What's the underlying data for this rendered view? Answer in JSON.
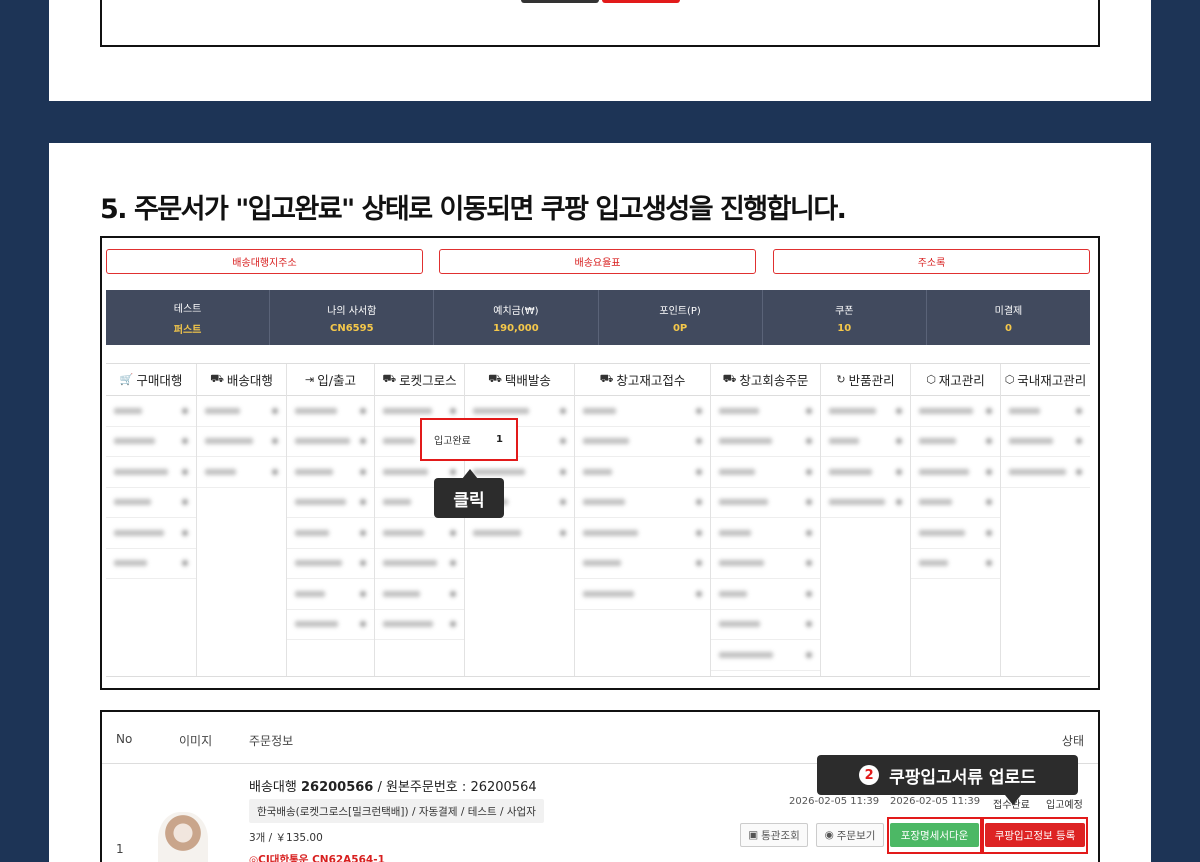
{
  "step": {
    "title": "5. 주문서가 \"입고완료\" 상태로 이동되면 쿠팡 입고생성을 진행합니다."
  },
  "links": [
    {
      "label": "배송대행지주소"
    },
    {
      "label": "배송요율표"
    },
    {
      "label": "주소록"
    }
  ],
  "stats": [
    {
      "label": "테스트",
      "value": "퍼스트"
    },
    {
      "label": "나의 사서함",
      "value": "CN6595"
    },
    {
      "label": "예치금(₩)",
      "value": "190,000"
    },
    {
      "label": "포인트(P)",
      "value": "0P"
    },
    {
      "label": "쿠폰",
      "value": "10"
    },
    {
      "label": "미결제",
      "value": "0"
    }
  ],
  "menu": {
    "columns": [
      {
        "label": "구매대행",
        "icon": "cart-icon"
      },
      {
        "label": "배송대행",
        "icon": "truck-icon"
      },
      {
        "label": "입/출고",
        "icon": "sign-in-icon"
      },
      {
        "label": "로켓그로스",
        "icon": "truck-icon"
      },
      {
        "label": "택배발송",
        "icon": "truck-icon"
      },
      {
        "label": "창고재고접수",
        "icon": "truck-icon"
      },
      {
        "label": "창고회송주문",
        "icon": "truck-icon"
      },
      {
        "label": "반품관리",
        "icon": "refresh-icon"
      },
      {
        "label": "재고관리",
        "icon": "box-icon"
      },
      {
        "label": "국내재고관리",
        "icon": "box-icon"
      }
    ],
    "highlight": {
      "label": "입고완료",
      "count": "1"
    },
    "callout": "클릭"
  },
  "order": {
    "headers": {
      "no": "No",
      "image": "이미지",
      "info": "주문정보",
      "status": "상태"
    },
    "row": {
      "no": "1",
      "title_prefix": "배송대행",
      "order_no": "26200566",
      "origin_label": "/ 원본주문번호 :",
      "origin_no": "26200564",
      "tags": "한국배송(로켓그로스[밀크런택배]) / 자동결제 / 테스트 / 사업자",
      "qty": "3개 / ￥135.00",
      "tracking": "CJ대한통운 CN62A564-1",
      "date1": "2026-02-05 11:39",
      "date2": "2026-02-05 11:39",
      "status1": "접수완료",
      "status2": "입고예정"
    },
    "buttons": {
      "customs": "통관조회",
      "view": "주문보기",
      "packing": "포장명세서다운",
      "coupang": "쿠팡입고정보 등록"
    },
    "callout": {
      "num": "2",
      "text": "쿠팡입고서류 업로드"
    }
  }
}
